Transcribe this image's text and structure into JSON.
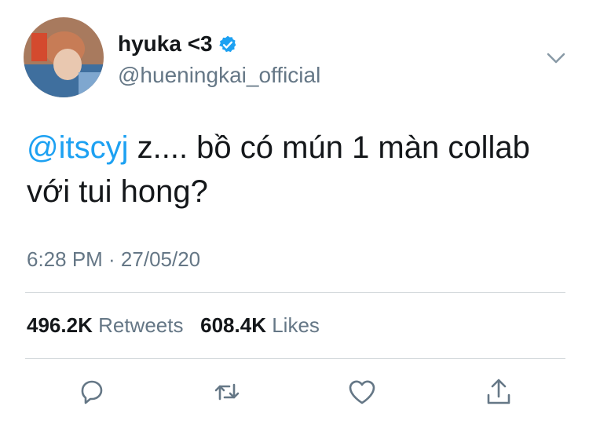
{
  "tweet": {
    "display_name": "hyuka <3",
    "handle": "@hueningkai_official",
    "mention": "@itscyj",
    "text_after_mention": " z.... bồ có mún 1 màn collab với tui hong?",
    "timestamp": "6:28 PM · 27/05/20"
  },
  "stats": {
    "retweets_count": "496.2K",
    "retweets_label": "Retweets",
    "likes_count": "608.4K",
    "likes_label": "Likes"
  },
  "icons": {
    "verified": "verified-badge-icon",
    "menu": "chevron-down-icon",
    "reply": "reply-icon",
    "retweet": "retweet-icon",
    "like": "heart-icon",
    "share": "share-icon"
  },
  "colors": {
    "accent": "#1da1f2",
    "muted": "#657786",
    "text": "#14171a",
    "divider": "#d5dadd"
  }
}
